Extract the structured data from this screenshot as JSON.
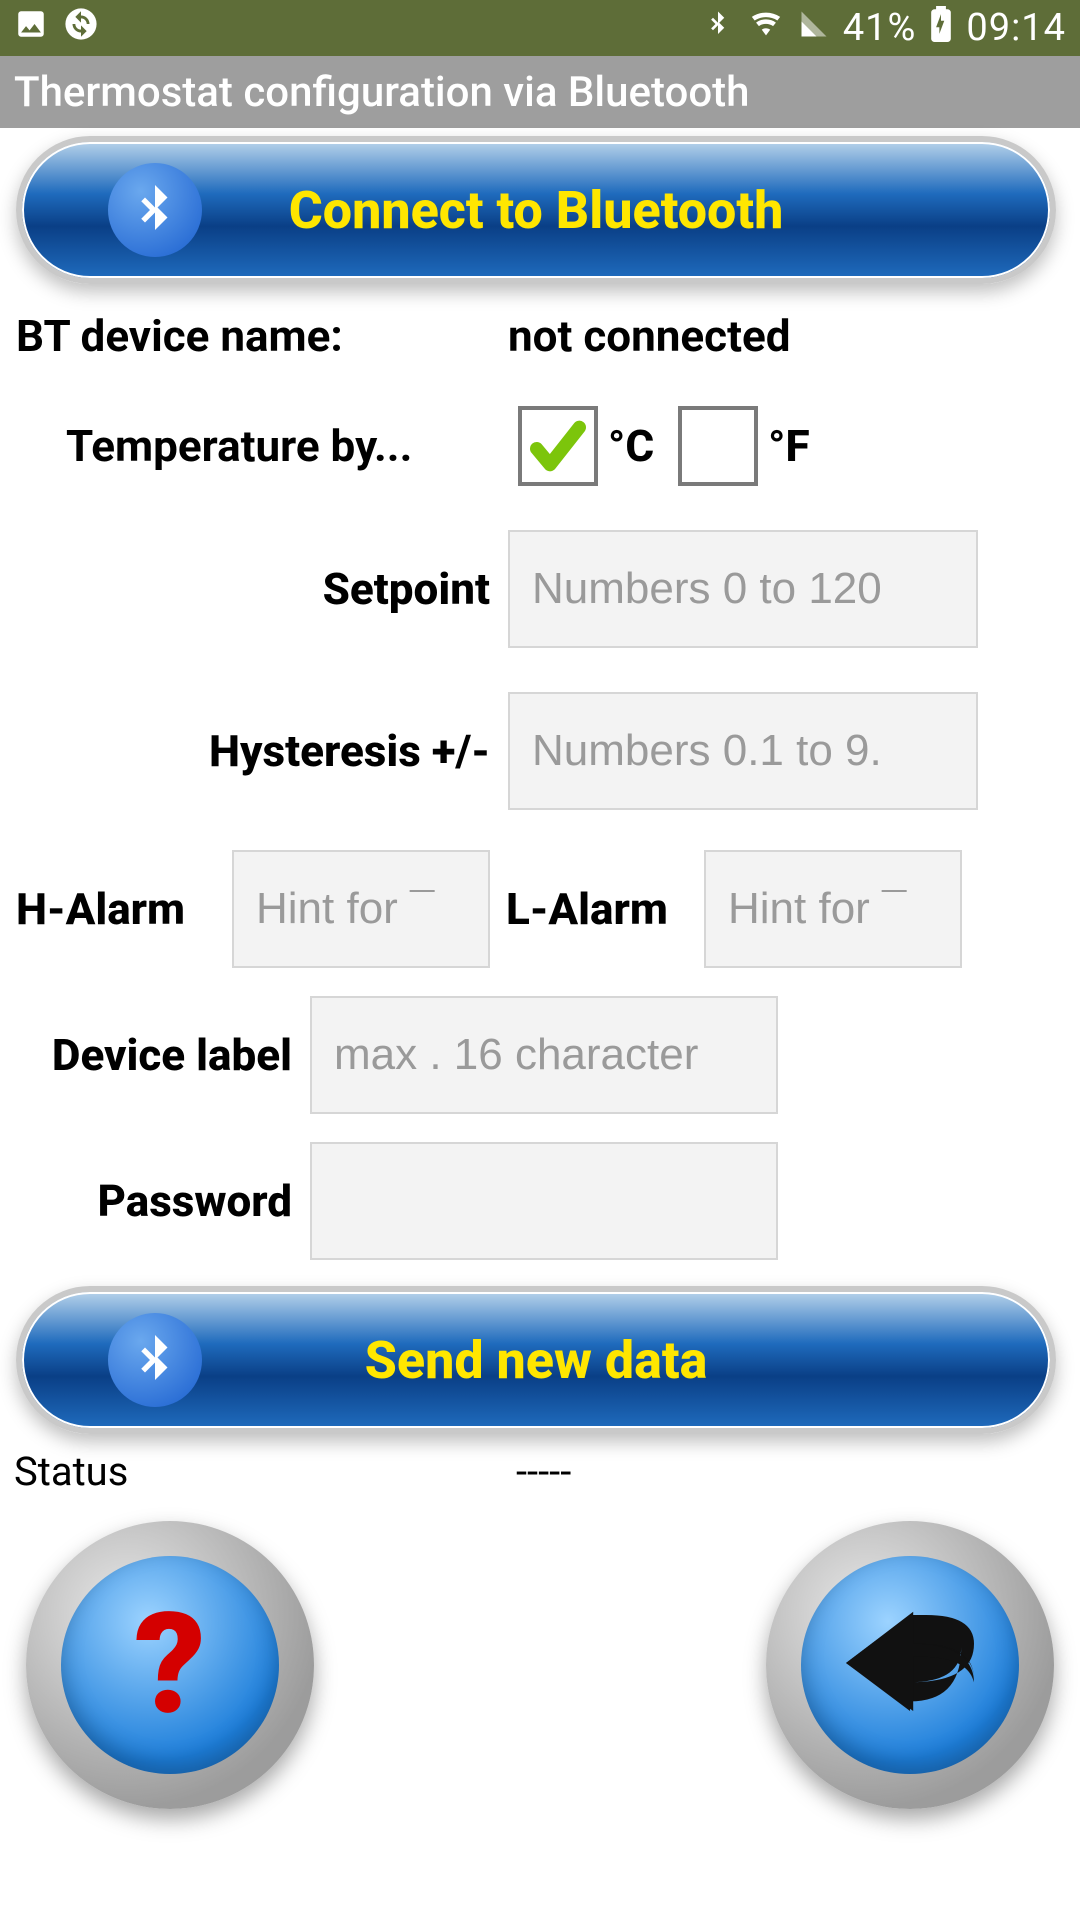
{
  "statusbar": {
    "battery_pct": "41%",
    "time": "09:14"
  },
  "appbar": {
    "title": "Thermostat configuration via Bluetooth"
  },
  "buttons": {
    "connect": "Connect to Bluetooth",
    "send": "Send new data"
  },
  "device": {
    "label": "BT device name:",
    "value": "not connected"
  },
  "temp": {
    "label": "Temperature by...",
    "celsius_unit": "°C",
    "fahrenheit_unit": "°F",
    "celsius_checked": true,
    "fahrenheit_checked": false
  },
  "form": {
    "setpoint": {
      "label": "Setpoint",
      "placeholder": "Numbers 0 to 120"
    },
    "hysteresis": {
      "label": "Hysteresis +/-",
      "placeholder": "Numbers 0.1 to 9."
    },
    "h_alarm": {
      "label": "H-Alarm",
      "placeholder": "Hint for ¯"
    },
    "l_alarm": {
      "label": "L-Alarm",
      "placeholder": "Hint for ¯"
    },
    "device_label": {
      "label": "Device label",
      "placeholder": "max . 16 character"
    },
    "password": {
      "label": "Password",
      "placeholder": ""
    }
  },
  "status": {
    "label": "Status",
    "value": "-----"
  }
}
